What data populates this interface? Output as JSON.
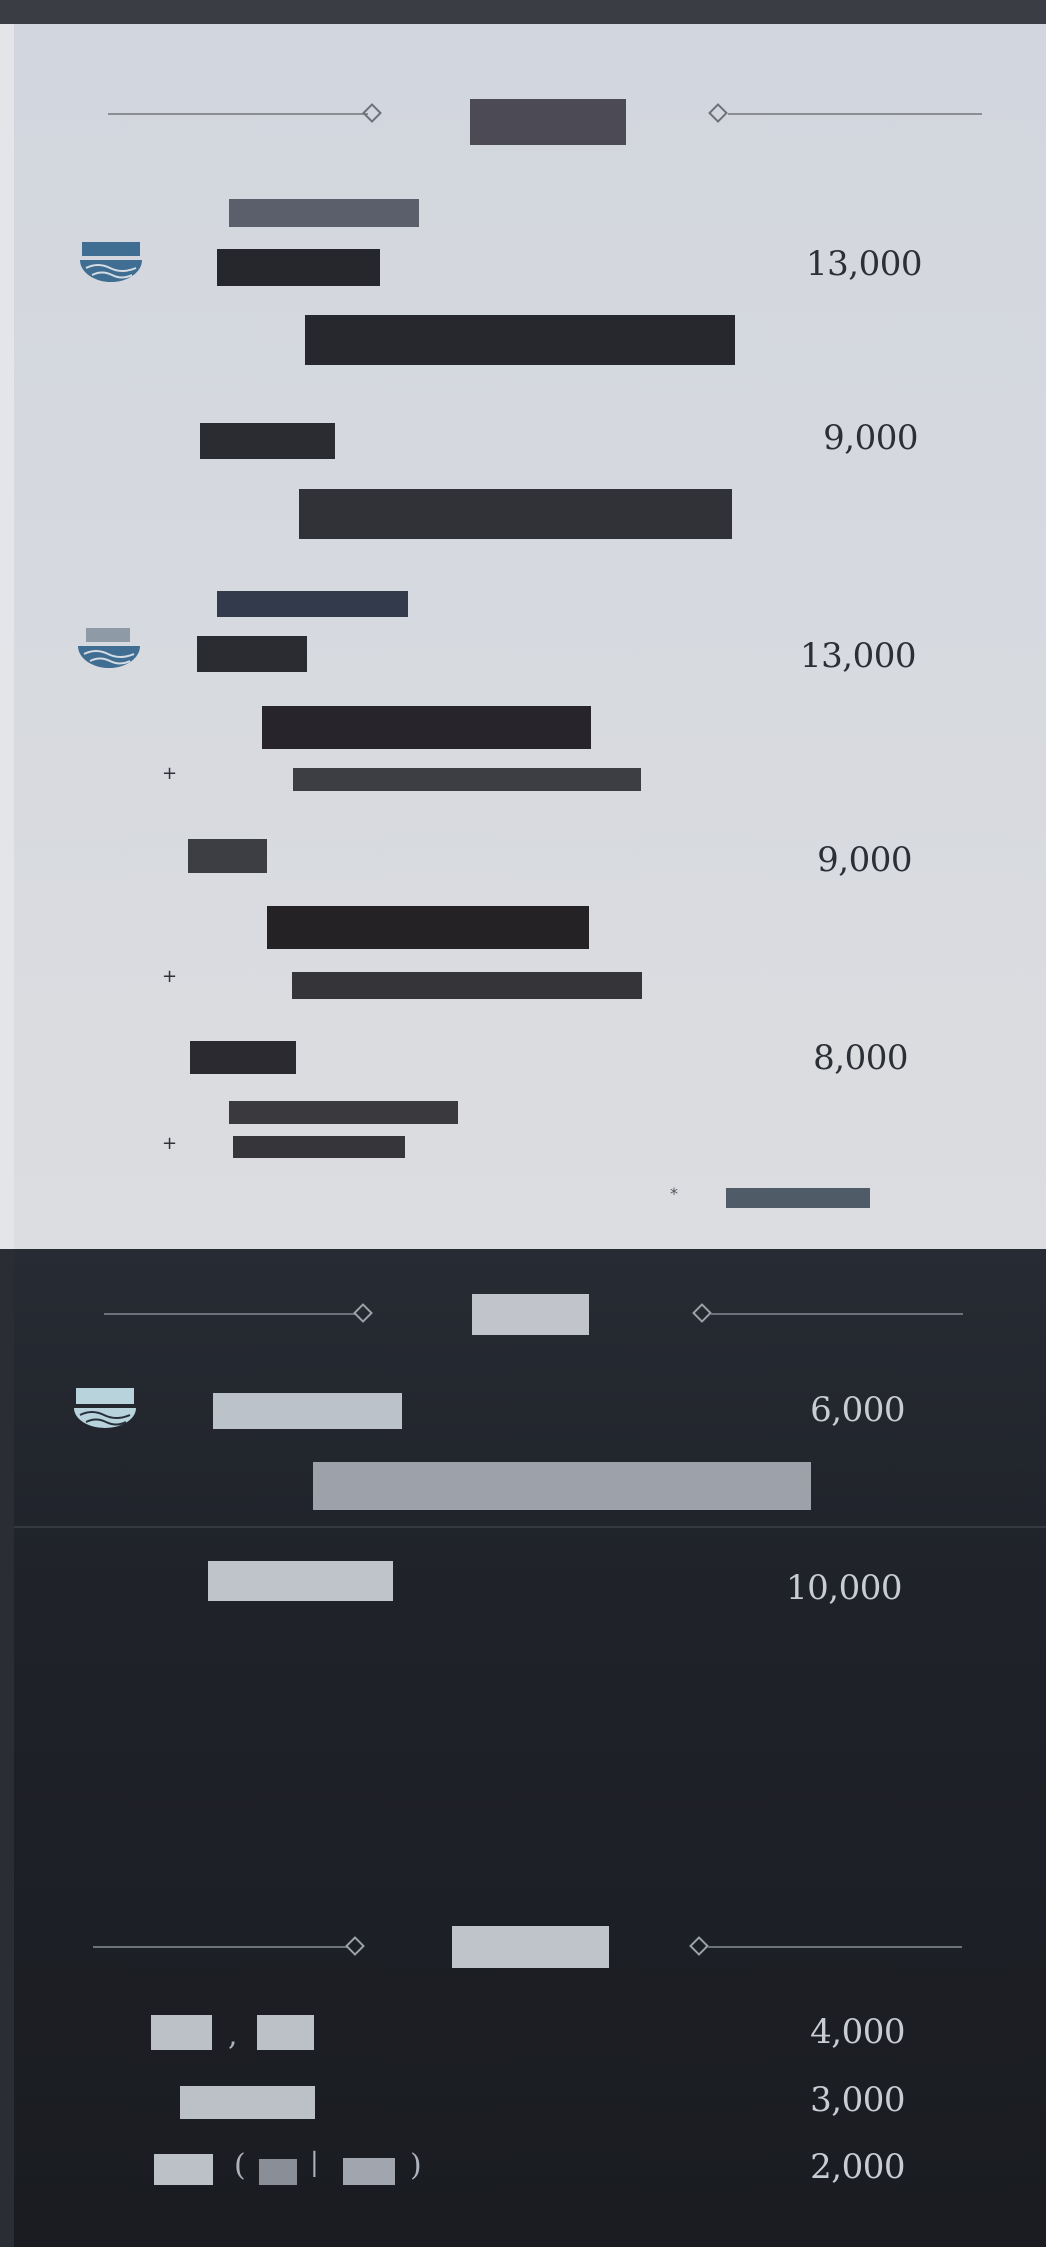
{
  "colors": {
    "light_bg": "#d4d7dd",
    "dark_bg": "#1f2229",
    "redaction_dark": "#2a2c32",
    "redaction_slate": "#5b5f6b",
    "redaction_navy": "#333a4c",
    "redaction_light": "#b4b9c1",
    "icon_blue": "#3f6e92",
    "icon_pale": "#b9d3dc"
  },
  "sections": [
    {
      "theme": "light",
      "items": [
        {
          "price": "13,000",
          "icon": "bowl-wave-icon",
          "has_add_ons": false
        },
        {
          "price": "9,000",
          "has_add_ons": false
        },
        {
          "price": "13,000",
          "icon": "bowl-wave-icon",
          "has_add_ons": true
        },
        {
          "price": "9,000",
          "has_add_ons": true
        },
        {
          "price": "8,000",
          "has_add_ons": true
        }
      ],
      "plus_mark": "+",
      "note_mark": "*"
    },
    {
      "theme": "dark",
      "items": [
        {
          "price": "6,000",
          "icon": "bowl-wave-icon"
        },
        {
          "price": "10,000"
        }
      ]
    },
    {
      "theme": "dark",
      "items": [
        {
          "price": "4,000",
          "separator": ","
        },
        {
          "price": "3,000"
        },
        {
          "price": "2,000",
          "open_paren": "(",
          "divider": "|",
          "close_paren": ")"
        }
      ]
    }
  ]
}
